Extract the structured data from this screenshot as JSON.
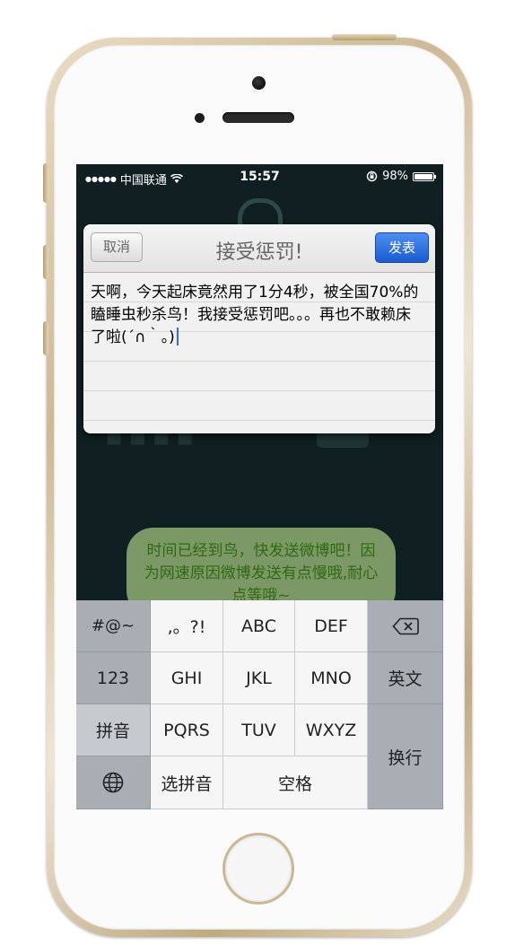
{
  "status_bar": {
    "carrier": "中国联通",
    "time": "15:57",
    "battery": "98%",
    "battery_level": 0.98
  },
  "compose": {
    "cancel_label": "取消",
    "title": "接受惩罚!",
    "send_label": "发表",
    "text": "天啊，今天起床竟然用了1分4秒，被全国70%的瞌睡虫秒杀鸟！我接受惩罚吧。。。再也不敢赖床了啦(´∩｀。)"
  },
  "toast": {
    "message": "时间已经到鸟，快发送微博吧！因为网速原因微博发送有点慢哦,耐心点等哦~"
  },
  "keyboard": {
    "left_column": [
      "#@~",
      "123",
      "拼音"
    ],
    "row1": [
      ",。?!",
      "ABC",
      "DEF"
    ],
    "row2": [
      "GHI",
      "JKL",
      "MNO"
    ],
    "row3": [
      "PQRS",
      "TUV",
      "WXYZ"
    ],
    "select_pinyin": "选拼音",
    "space": "空格",
    "english": "英文",
    "return": "换行",
    "delete_icon": "backspace-icon",
    "globe_icon": "globe-icon"
  },
  "colors": {
    "send_button": "#2a6ee0",
    "toast_bg": "#7c9866",
    "toast_text": "#2f6a12",
    "screen_bg": "#101f22"
  }
}
